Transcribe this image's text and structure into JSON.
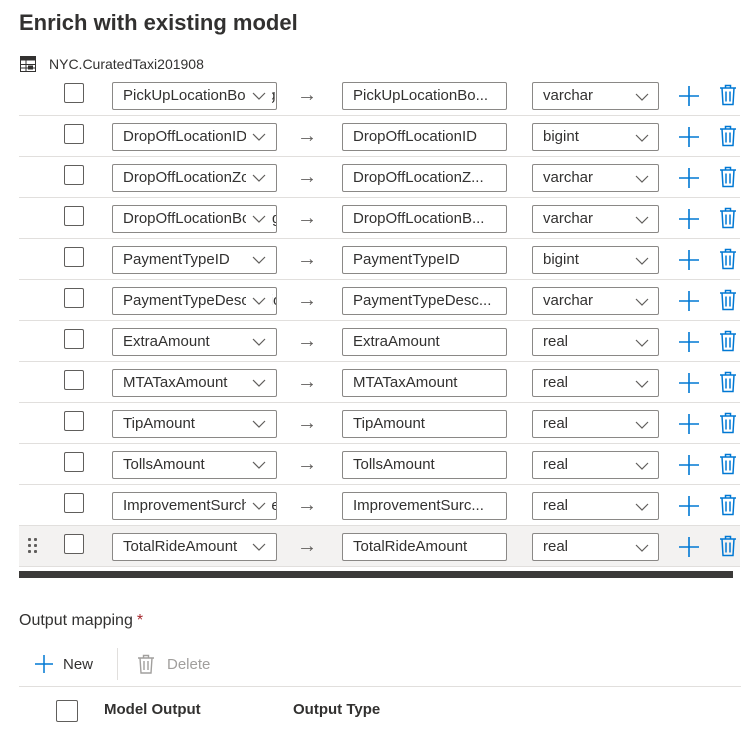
{
  "title": "Enrich with existing model",
  "table_name": "NYC.CuratedTaxi201908",
  "arrow": "→",
  "rows": [
    {
      "source": "PickUpLocationBorough",
      "target": "PickUpLocationBo...",
      "type": "varchar"
    },
    {
      "source": "DropOffLocationID",
      "target": "DropOffLocationID",
      "type": "bigint"
    },
    {
      "source": "DropOffLocationZone",
      "target": "DropOffLocationZ...",
      "type": "varchar"
    },
    {
      "source": "DropOffLocationBorough",
      "target": "DropOffLocationB...",
      "type": "varchar"
    },
    {
      "source": "PaymentTypeID",
      "target": "PaymentTypeID",
      "type": "bigint"
    },
    {
      "source": "PaymentTypeDescription",
      "target": "PaymentTypeDesc...",
      "type": "varchar"
    },
    {
      "source": "ExtraAmount",
      "target": "ExtraAmount",
      "type": "real"
    },
    {
      "source": "MTATaxAmount",
      "target": "MTATaxAmount",
      "type": "real"
    },
    {
      "source": "TipAmount",
      "target": "TipAmount",
      "type": "real"
    },
    {
      "source": "TollsAmount",
      "target": "TollsAmount",
      "type": "real"
    },
    {
      "source": "ImprovementSurcharge",
      "target": "ImprovementSurc...",
      "type": "real"
    },
    {
      "source": "TotalRideAmount",
      "target": "TotalRideAmount",
      "type": "real"
    }
  ],
  "output_mapping": {
    "label": "Output mapping",
    "required_mark": "*",
    "new_label": "New",
    "delete_label": "Delete",
    "columns": [
      "Model Output",
      "Output Type"
    ]
  },
  "colors": {
    "accent": "#0078d4",
    "text": "#323130",
    "disabled": "#a19f9d",
    "required": "#a4262c"
  },
  "icons": {
    "table": "table-icon",
    "add": "plus-icon",
    "delete": "trash-icon",
    "dropdown": "chevron-down-icon",
    "drag": "gripper-icon"
  }
}
